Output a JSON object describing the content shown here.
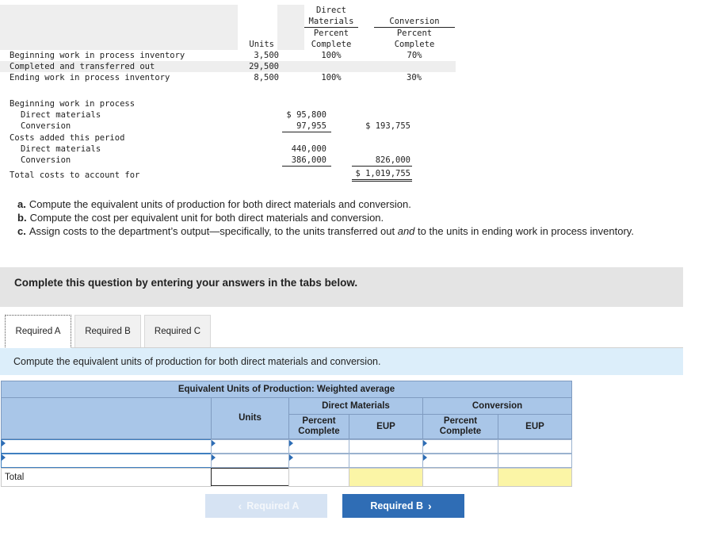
{
  "info_table": {
    "col_headers": {
      "units": "Units",
      "dm": [
        "Direct",
        "Materials",
        "Percent",
        "Complete"
      ],
      "conv": [
        "Conversion",
        "Percent",
        "Complete"
      ]
    },
    "rows": [
      {
        "label": "Beginning work in process inventory",
        "units": "3,500",
        "dm": "100%",
        "conv": "70%"
      },
      {
        "label": "Completed and transferred out",
        "units": "29,500",
        "dm": "",
        "conv": ""
      },
      {
        "label": "Ending work in process inventory",
        "units": "8,500",
        "dm": "100%",
        "conv": "30%"
      }
    ],
    "costs": {
      "bwip_label": "Beginning work in process",
      "bwip_dm_label": "Direct materials",
      "bwip_dm": "$ 95,800",
      "bwip_conv_label": "Conversion",
      "bwip_conv": "97,955",
      "bwip_total": "$ 193,755",
      "added_label": "Costs added this period",
      "added_dm_label": "Direct materials",
      "added_dm": "440,000",
      "added_conv_label": "Conversion",
      "added_conv": "386,000",
      "added_total": "826,000",
      "total_label": "Total costs to account for",
      "total": "$ 1,019,755"
    }
  },
  "questions": [
    {
      "letter": "a.",
      "text": "Compute the equivalent units of production for both direct materials and conversion."
    },
    {
      "letter": "b.",
      "text": "Compute the cost per equivalent unit for both direct materials and conversion."
    },
    {
      "letter": "c.",
      "text_pre": "Assign costs to the department’s output—specifically, to the units transferred out ",
      "text_em": "and",
      "text_post": " to the units in ending work in process inventory."
    }
  ],
  "banner": "Complete this question by entering your answers in the tabs below.",
  "tabs": [
    "Required A",
    "Required B",
    "Required C"
  ],
  "instruction": "Compute the equivalent units of production for both direct materials and conversion.",
  "grid": {
    "title": "Equivalent Units of Production: Weighted average",
    "dm_header": "Direct Materials",
    "conv_header": "Conversion",
    "units_header": "Units",
    "percent_complete": "Percent Complete",
    "eup": "EUP",
    "total_label": "Total"
  },
  "nav": {
    "prev": "Required A",
    "next": "Required B"
  },
  "colors": {
    "header_blue": "#a9c6e8",
    "instruction_blue": "#dceefa",
    "next_button": "#2f6db5",
    "total_yellow": "#fbf5a6"
  }
}
